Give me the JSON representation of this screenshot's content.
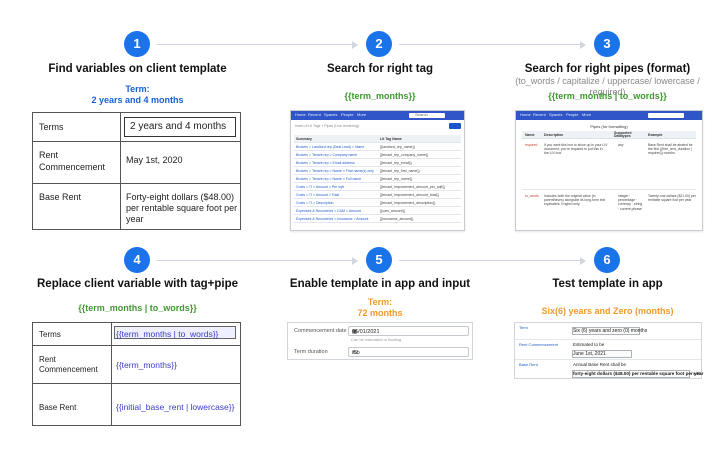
{
  "steps": [
    {
      "num": "1",
      "title": "Find variables on client template"
    },
    {
      "num": "2",
      "title": "Search for right tag"
    },
    {
      "num": "3",
      "title": "Search for right pipes (format)"
    },
    {
      "num": "4",
      "title": "Replace client variable with tag+pipe"
    },
    {
      "num": "5",
      "title": "Enable template in app and input"
    },
    {
      "num": "6",
      "title": "Test template in app"
    }
  ],
  "step1": {
    "term_label": "Term:",
    "term_value": "2 years and 4 months",
    "table": [
      {
        "key": "Terms",
        "value": "2 years and 4 months"
      },
      {
        "key": "Rent Commencement",
        "value": "May 1st, 2020"
      },
      {
        "key": "Base Rent",
        "value": "Forty-eight dollars ($48.00) per rentable square foot per year"
      }
    ]
  },
  "step2": {
    "tag": "{{term_months}}",
    "nav": [
      "Home",
      "Recent",
      "Spaces",
      "People",
      "More"
    ],
    "search_placeholder": "Search",
    "crumb": "Index of Lit Tags + Pipes (Live-rendering)",
    "columns": [
      "Summary",
      "Lit Tag Name"
    ],
    "rows": [
      [
        "Brokers > Landlord rep (Deal Lead) > Name",
        "{{landlord_rep_name}}"
      ],
      [
        "Brokers > Tenant rep > Company name",
        "{{tenant_rep_company_name}}"
      ],
      [
        "Brokers > Tenant rep > Email address",
        "{{tenant_rep_email}}"
      ],
      [
        "Brokers > Tenant rep > Name > First name(s) only",
        "{{tenant_rep_first_name}}"
      ],
      [
        "Brokers > Tenant rep > Name > Full name",
        "{{tenant_rep_name}}"
      ],
      [
        "Costs > TI > Amount > Per sqft",
        "{{tenant_improvement_amount_per_sqft}}"
      ],
      [
        "Costs > TI > Amount > Total",
        "{{tenant_improvement_amount_total}}"
      ],
      [
        "Costs > TI > Description",
        "{{tenant_improvement_description}}"
      ],
      [
        "Expenses & Recoveries > CAM > Amount",
        "{{cam_amount}}"
      ],
      [
        "Expenses & Recoveries > Insurance > Amount",
        "{{insurance_amount}}"
      ]
    ]
  },
  "step3": {
    "sub": "(to_words / capitalize / uppercase/ lowercase / required)",
    "tag": "{{term_months | to_words}}",
    "page_title": "Pipes (for formatting)",
    "columns": [
      "Name",
      "Description",
      "Supported Datatypes",
      "Example"
    ],
    "rows": [
      {
        "name": "required",
        "desc": "If you want this box to show up in your LIV document, you're required to put this in the LIV box.",
        "types": "any",
        "example": "Base Rent shall be abated for the first {{free_rent_duration | required}} months."
      },
      {
        "name": "to_words",
        "desc": "Includes both the original value (in parentheses) alongside its long-form text equivalent. English only.",
        "types": "integer · percentage · currency · string · current phrase",
        "example": "Twenty-one dollars ($21.00) per rentable square foot per year"
      }
    ]
  },
  "step4": {
    "table": [
      {
        "key": "Terms",
        "value": "{{term_months | to_words}}"
      },
      {
        "key": "Rent Commencement",
        "value": "{{term_months}}"
      },
      {
        "key": "Base Rent",
        "value": "{{initial_base_rent | lowercase}}"
      }
    ]
  },
  "step5": {
    "term_label": "Term:",
    "term_value": "72 months",
    "fields": [
      {
        "label": "Commencement date",
        "value": "06/01/2021",
        "hint": "Can be estimated or floating"
      },
      {
        "label": "Term duration",
        "value": "72",
        "suffix": "mo"
      }
    ]
  },
  "step6": {
    "term_value": "Six(6) years and Zero (months)",
    "rows": [
      {
        "label": "Term",
        "text": "Six (6) years and zero (0) months"
      },
      {
        "label": "Rent Commencement",
        "text": "Estimated to be",
        "box": "June 1st, 2021"
      },
      {
        "label": "Base Rent",
        "text": "Annual Base Rent shall be",
        "box": "forty-eight dollars ($48.00) per rentable square foot per year",
        "tail": "with"
      }
    ]
  }
}
